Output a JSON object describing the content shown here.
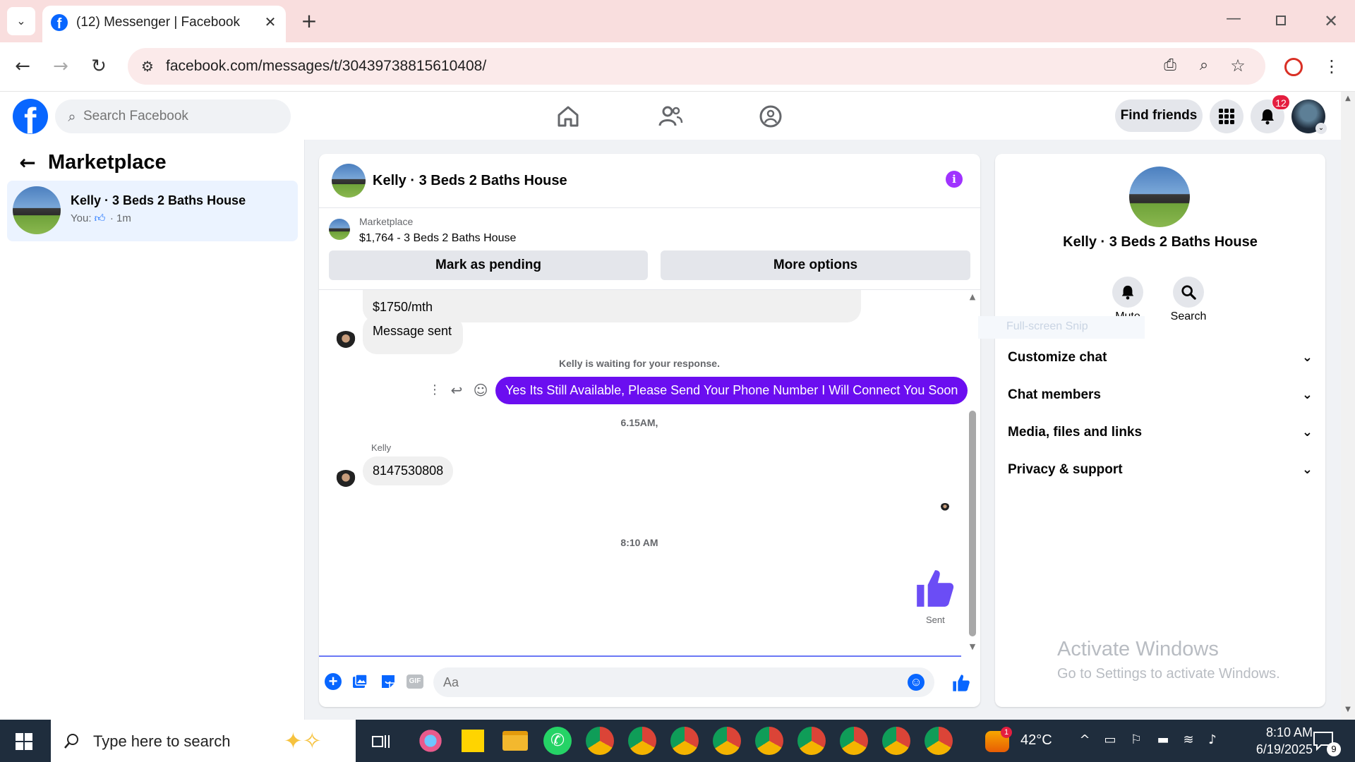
{
  "browser": {
    "tab_title": "(12) Messenger | Facebook",
    "url": "facebook.com/messages/t/30439738815610408/"
  },
  "fb": {
    "search_placeholder": "Search Facebook",
    "find_friends": "Find friends",
    "notif_count": "12"
  },
  "left": {
    "title": "Marketplace",
    "convo": {
      "name": "Kelly · 3 Beds 2 Baths House",
      "preview_prefix": "You:",
      "preview_suffix": "· 1m"
    }
  },
  "chat": {
    "header_name": "Kelly · 3 Beds 2 Baths House",
    "listing_label": "Marketplace",
    "listing_title": "$1,764 - 3 Beds 2 Baths House",
    "mark_pending": "Mark as pending",
    "more_options": "More options",
    "msg_partial": "$1750/mth",
    "msg_sent": "Message sent",
    "waiting": "Kelly is waiting for your response.",
    "my_msg": "Yes Its Still Available, Please Send Your Phone Number I Will Connect You Soon",
    "time1": "6.15AM,",
    "sender": "Kelly",
    "phone_msg": "8147530808",
    "time2": "8:10 AM",
    "sent_label": "Sent",
    "composer_placeholder": "Aa"
  },
  "info": {
    "name": "Kelly · 3 Beds 2 Baths House",
    "mute": "Mute",
    "search": "Search",
    "snip": "Full-screen Snip",
    "menu": [
      "Customize chat",
      "Chat members",
      "Media, files and links",
      "Privacy & support"
    ]
  },
  "watermark": {
    "line1": "Activate Windows",
    "line2": "Go to Settings to activate Windows."
  },
  "taskbar": {
    "search_placeholder": "Type here to search",
    "weather": "42°C",
    "weather_badge": "1",
    "time": "8:10 AM",
    "date": "6/19/2025",
    "notif_count": "9"
  },
  "colors": {
    "fb_blue": "#0866ff",
    "messenger_purple": "#7118f2",
    "my_bubble": "#6b0ef0"
  }
}
